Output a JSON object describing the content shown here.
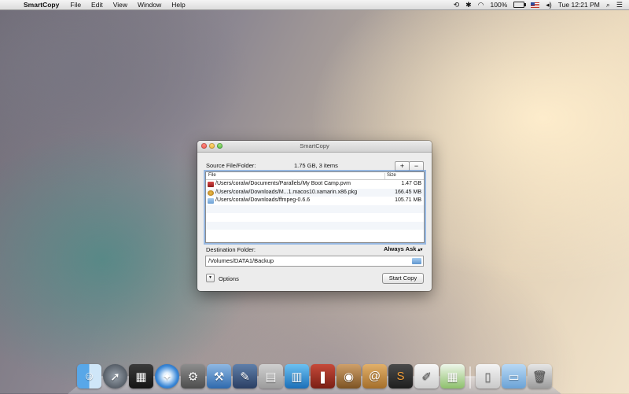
{
  "menubar": {
    "app_name": "SmartCopy",
    "menus": [
      "File",
      "Edit",
      "View",
      "Window",
      "Help"
    ],
    "battery_percent": "100%",
    "clock": "Tue 12:21 PM"
  },
  "window": {
    "title": "SmartCopy",
    "source_label": "Source File/Folder:",
    "source_summary": "1.75 GB, 3 items",
    "add_label": "+",
    "remove_label": "−",
    "table": {
      "headers": {
        "file": "File",
        "size": "Size"
      },
      "rows": [
        {
          "icon": "parallels-vm-icon",
          "path": "/Users/coralw/Documents/Parallels/My Boot Camp.pvm",
          "size": "1.47 GB"
        },
        {
          "icon": "package-icon",
          "path": "/Users/coralw/Downloads/M...1.macos10.xamarin.x86.pkg",
          "size": "166.45 MB"
        },
        {
          "icon": "folder-icon",
          "path": "/Users/coralw/Downloads/ffmpeg-0.6.6",
          "size": "105.71 MB"
        }
      ]
    },
    "destination_label": "Destination Folder:",
    "always_ask": "Always Ask",
    "destination_path": "/Volumes/DATA1/Backup",
    "options_label": "Options",
    "start_button": "Start Copy"
  },
  "dock": {
    "apps": [
      "finder-icon",
      "launchpad-icon",
      "iphoto-icon",
      "safari-icon",
      "system-preferences-icon",
      "xcode-icon",
      "instruments-icon",
      "preview-icon",
      "keynote-icon",
      "book-icon",
      "image-capture-icon",
      "contacts-icon",
      "sublime-text-icon",
      "textedit-icon",
      "numbers-icon"
    ],
    "stacks": [
      "documents-stack-icon",
      "downloads-folder-icon",
      "trash-icon"
    ]
  }
}
